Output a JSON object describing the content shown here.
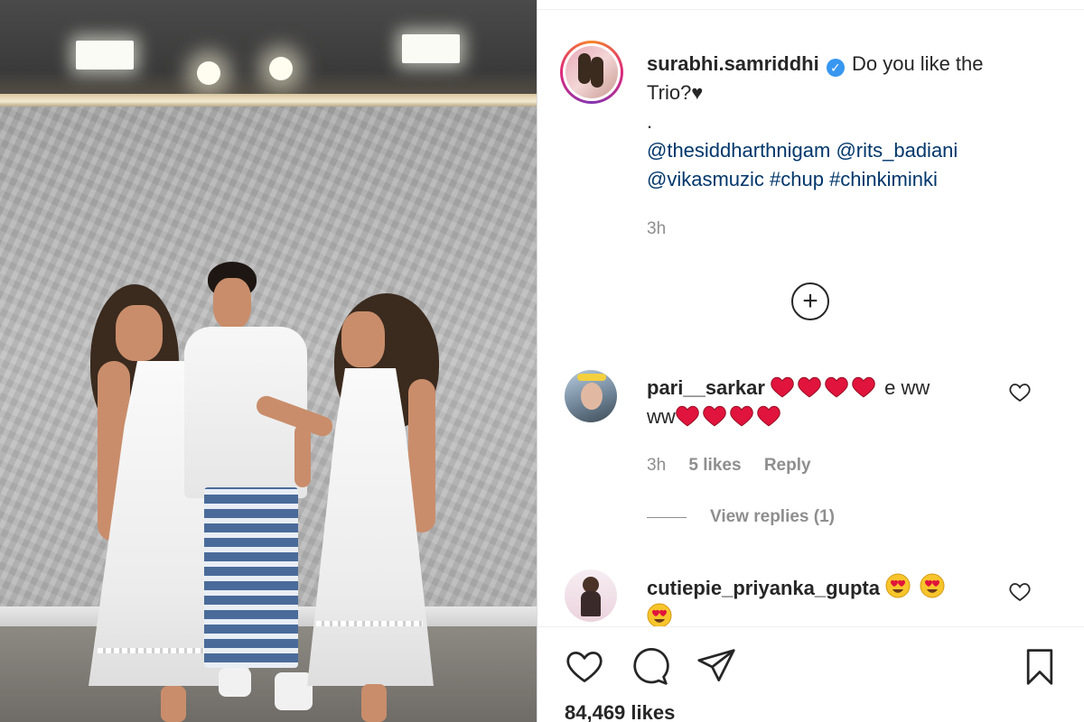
{
  "post": {
    "username": "surabhi.samriddhi",
    "verified": true,
    "caption_line1": "Do you like the",
    "caption_line2": "Trio?♥",
    "caption_dot": ".",
    "mentions_line1": "@thesiddharthnigam @rits_badiani",
    "mentions_line2": "@vikasmuzic #chup #chinkiminki",
    "time": "3h",
    "likes": "84,469 likes"
  },
  "comments": [
    {
      "username": "pari__sarkar",
      "text_after_hearts": "e ww",
      "text_line2_prefix": "ww",
      "hearts_line1": 4,
      "hearts_line2": 4,
      "time": "3h",
      "likes": "5 likes",
      "reply_label": "Reply",
      "view_replies": "View replies (1)"
    },
    {
      "username": "cutiepie_priyanka_gupta",
      "emoji_count": 3
    }
  ],
  "icons": {
    "verified": "verified-badge-icon",
    "load_more": "plus-circle-icon",
    "like": "heart-icon",
    "comment": "comment-bubble-icon",
    "share": "paper-plane-icon",
    "save": "bookmark-icon"
  }
}
